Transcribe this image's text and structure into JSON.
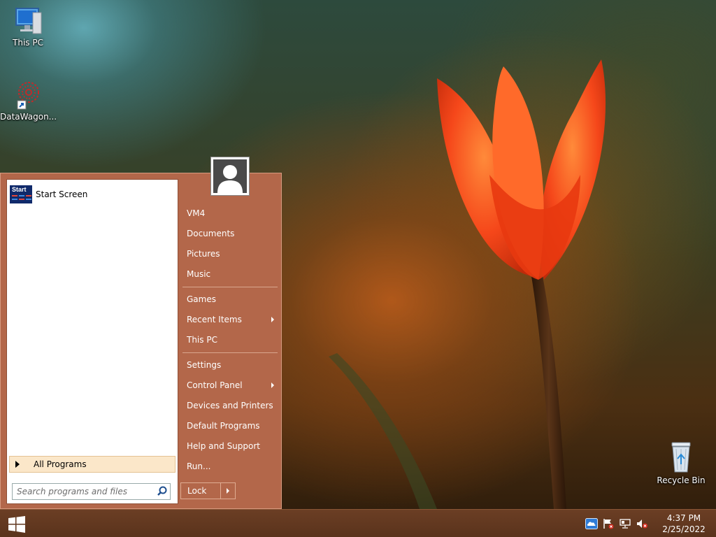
{
  "desktop": {
    "icons": [
      {
        "label": "This PC"
      },
      {
        "label": "DataWagon..."
      },
      {
        "label": "Recycle Bin"
      }
    ]
  },
  "start_menu": {
    "pinned": [
      {
        "label": "Start Screen",
        "tile_text": "Start"
      }
    ],
    "all_programs_label": "All Programs",
    "search_placeholder": "Search programs and files",
    "user_name": "VM4",
    "links": [
      {
        "label": "Documents"
      },
      {
        "label": "Pictures"
      },
      {
        "label": "Music"
      },
      {
        "label": "Games"
      },
      {
        "label": "Recent Items"
      },
      {
        "label": "This PC"
      },
      {
        "label": "Settings"
      },
      {
        "label": "Control Panel"
      },
      {
        "label": "Devices and Printers"
      },
      {
        "label": "Default Programs"
      },
      {
        "label": "Help and Support"
      },
      {
        "label": "Run..."
      }
    ],
    "lock_label": "Lock"
  },
  "taskbar": {
    "time": "4:37 PM",
    "date": "2/25/2022",
    "tray_icons": [
      "cloud-icon",
      "action-center-flag-icon",
      "network-icon",
      "volume-muted-icon"
    ]
  },
  "colors": {
    "menu_bg": "#b3674a",
    "taskbar_bg": "#5a331c",
    "all_programs_highlight": "#fbe7c9"
  }
}
